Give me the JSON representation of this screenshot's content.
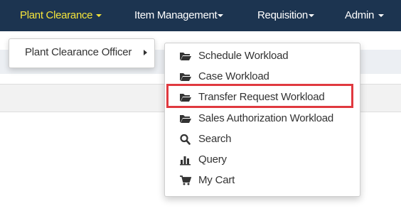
{
  "navbar": {
    "items": [
      {
        "label": "Plant Clearance",
        "active": true
      },
      {
        "label": "Item Management"
      },
      {
        "label": "Requisition"
      },
      {
        "label": "Admin"
      }
    ]
  },
  "submenu": {
    "label": "Plant Clearance Officer"
  },
  "dropdown": {
    "items": [
      {
        "label": "Schedule Workload",
        "icon": "folder-open-icon"
      },
      {
        "label": "Case Workload",
        "icon": "folder-open-icon"
      },
      {
        "label": "Transfer Request Workload",
        "icon": "folder-open-icon",
        "highlighted": true
      },
      {
        "label": "Sales Authorization Workload",
        "icon": "folder-open-icon"
      },
      {
        "label": "Search",
        "icon": "search-icon"
      },
      {
        "label": "Query",
        "icon": "bar-chart-icon"
      },
      {
        "label": "My Cart",
        "icon": "cart-icon"
      }
    ]
  },
  "colors": {
    "navbar_bg": "#1c3450",
    "active_nav": "#f5e43a",
    "highlight_border": "#e0393f"
  }
}
